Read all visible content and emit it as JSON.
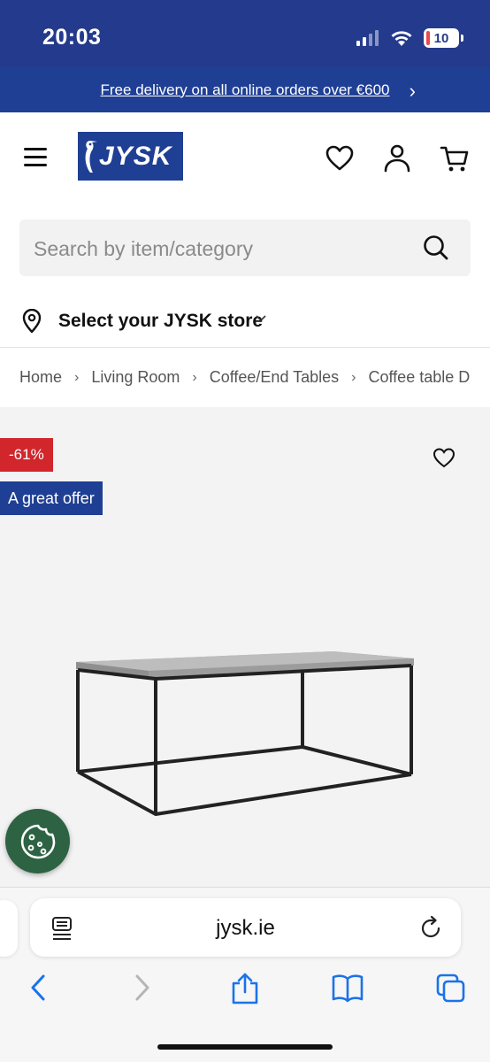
{
  "status": {
    "time": "20:03",
    "battery": "10",
    "battery_level": 0.1
  },
  "promo": {
    "text": "Free delivery on all online orders over €600"
  },
  "header": {
    "logo_text": "JYSK",
    "icons": [
      "menu-icon",
      "heart-icon",
      "user-icon",
      "cart-icon"
    ]
  },
  "search": {
    "placeholder": "Search by item/category",
    "value": ""
  },
  "store": {
    "label": "Select your JYSK store"
  },
  "breadcrumb": [
    "Home",
    "Living Room",
    "Coffee/End Tables",
    "Coffee table D"
  ],
  "product": {
    "discount": "-61%",
    "offer_label": "A great offer"
  },
  "browser": {
    "url": "jysk.ie"
  },
  "colors": {
    "brand_blue": "#1f3f94",
    "status_blue": "#243a8c",
    "discount_red": "#d0262c",
    "cookie_green": "#2d6343",
    "safari_blue": "#1a73e8"
  }
}
